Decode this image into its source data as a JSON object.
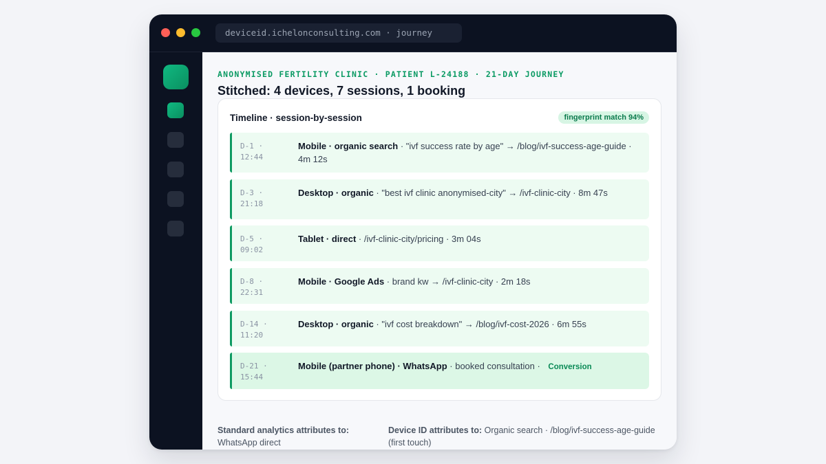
{
  "browser": {
    "url": "deviceid.ichelonconsulting.com · journey"
  },
  "header": {
    "eyebrow": "ANONYMISED FERTILITY CLINIC · PATIENT L-24188 · 21-DAY JOURNEY",
    "title": "Stitched: 4 devices, 7 sessions, 1 booking"
  },
  "timeline": {
    "title": "Timeline · session-by-session",
    "badge": "fingerprint match 94%",
    "rows": [
      {
        "day": "D-1 ·",
        "time": "12:44",
        "source": "Mobile · organic search",
        "detail": " · \"ivf success rate by age\" → /blog/ivf-success-age-guide · 4m 12s"
      },
      {
        "day": "D-3 ·",
        "time": "21:18",
        "source": "Desktop · organic",
        "detail": " · \"best ivf clinic anonymised-city\" → /ivf-clinic-city · 8m 47s"
      },
      {
        "day": "D-5 ·",
        "time": "09:02",
        "source": "Tablet · direct",
        "detail": " · /ivf-clinic-city/pricing · 3m 04s"
      },
      {
        "day": "D-8 ·",
        "time": "22:31",
        "source": "Mobile · Google Ads",
        "detail": " · brand kw → /ivf-clinic-city · 2m 18s"
      },
      {
        "day": "D-14 ·",
        "time": "11:20",
        "source": "Desktop · organic",
        "detail": " · \"ivf cost breakdown\" → /blog/ivf-cost-2026 · 6m 55s"
      },
      {
        "day": "D-21 ·",
        "time": "15:44",
        "source": "Mobile (partner phone) · WhatsApp",
        "detail": " · booked consultation · ",
        "tag": "Conversion"
      }
    ]
  },
  "footer": {
    "standard_label": "Standard analytics attributes to:",
    "standard_value": "WhatsApp direct",
    "deviceid_label": "Device ID attributes to:",
    "deviceid_value": "Organic search · /blog/ivf-success-age-guide (first touch)"
  },
  "colors": {
    "accent": "#0e9a62",
    "sidebar": "#0c1221",
    "row_bg": "#edfbf2"
  }
}
